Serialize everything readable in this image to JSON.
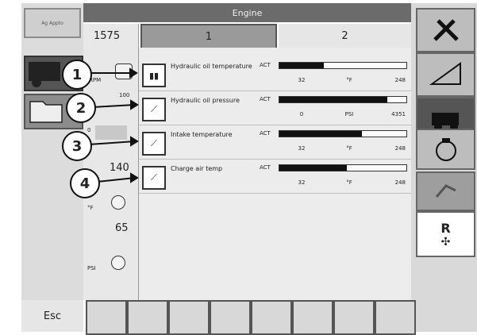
{
  "header": {
    "title": "Engine"
  },
  "tabs": [
    {
      "label": "1"
    },
    {
      "label": "2"
    }
  ],
  "logo": {
    "text": "Ag Appto"
  },
  "gauges": {
    "rpm": {
      "value": "1575",
      "unit": "RPM"
    },
    "fuel": {
      "value": "100"
    },
    "temp": {
      "value": "0"
    },
    "charge_temp": {
      "value": "140",
      "unit": "°F"
    },
    "pressure": {
      "value": "65",
      "unit": "PSI"
    }
  },
  "rows": [
    {
      "label": "Hydraulic oil temperature",
      "icon": "thermometer-icon",
      "act": "ACT",
      "min": "32",
      "unit": "°F",
      "max": "248",
      "fill": 0.35
    },
    {
      "label": "Hydraulic oil pressure",
      "icon": "pressure-gauge-icon",
      "act": "ACT",
      "min": "0",
      "unit": "PSI",
      "max": "4351",
      "fill": 0.85
    },
    {
      "label": "Intake temperature",
      "icon": "intake-gauge-icon",
      "act": "ACT",
      "min": "32",
      "unit": "°F",
      "max": "248",
      "fill": 0.65
    },
    {
      "label": "Charge air temp",
      "icon": "charge-air-gauge-icon",
      "act": "ACT",
      "min": "32",
      "unit": "°F",
      "max": "248",
      "fill": 0.53
    }
  ],
  "callouts": [
    "1",
    "2",
    "3",
    "4"
  ],
  "right_buttons": [
    {
      "icon": "tools-icon"
    },
    {
      "icon": "slope-icon"
    },
    {
      "icon": "combine-icon"
    },
    {
      "icon": "engine-icon"
    },
    {
      "icon": "hand-icon"
    },
    {
      "icon": "reverse-fan-icon",
      "label": "R"
    }
  ],
  "bottom": {
    "esc_label": "Esc",
    "softkey_count": 8
  }
}
